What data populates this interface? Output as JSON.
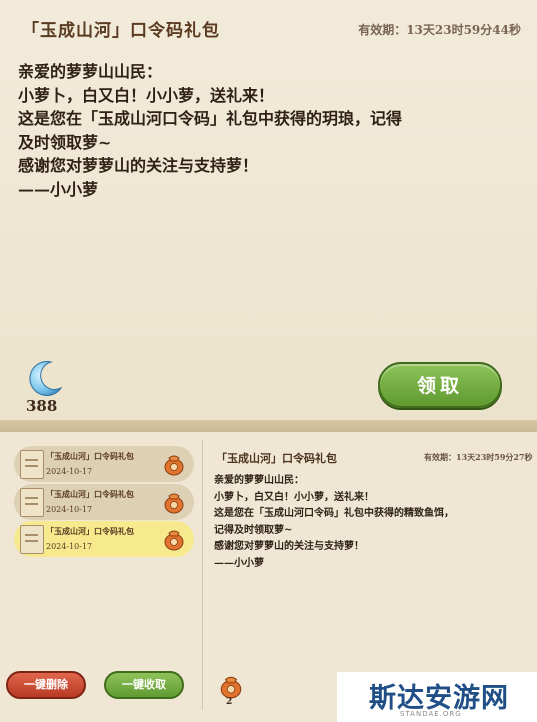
{
  "top_mail": {
    "title": "「玉成山河」口令码礼包",
    "expiry": "有效期：13天23时59分44秒",
    "body_lines": [
      "亲爱的萝萝山山民：",
      "小萝卜，白又白！小小萝，送礼来！",
      "这是您在「玉成山河口令码」礼包中获得的玥琅，记得",
      "及时领取萝~",
      "感谢您对萝萝山的关注与支持萝！",
      "——小小萝"
    ],
    "reward": {
      "icon": "crescent-moon-icon",
      "count": "388"
    },
    "claim_label": "领取"
  },
  "mail_list": {
    "items": [
      {
        "title": "「玉成山河」口令码礼包",
        "date": "2024-10-17",
        "selected": false
      },
      {
        "title": "「玉成山河」口令码礼包",
        "date": "2024-10-17",
        "selected": false
      },
      {
        "title": "「玉成山河」口令码礼包",
        "date": "2024-10-17",
        "selected": true
      }
    ],
    "delete_all_label": "一键删除",
    "collect_all_label": "一键收取"
  },
  "detail_mail": {
    "title": "「玉成山河」口令码礼包",
    "expiry": "有效期：13天23时59分27秒",
    "body_lines": [
      "亲爱的萝萝山山民：",
      "小萝卜，白又白！小小萝，送礼来！",
      "这是您在「玉成山河口令码」礼包中获得的精致鱼饵，",
      "记得及时领取萝~",
      "感谢您对萝萝山的关注与支持萝！",
      "——小小萝"
    ],
    "reward": {
      "icon": "gift-bag-icon",
      "count": "2"
    }
  },
  "watermark": {
    "text": "斯达安游网",
    "sub": "STANDAE.ORG"
  },
  "colors": {
    "accent_green": "#6fa83e",
    "delete_red": "#c9442c",
    "selected_item": "#f7ea8e"
  }
}
